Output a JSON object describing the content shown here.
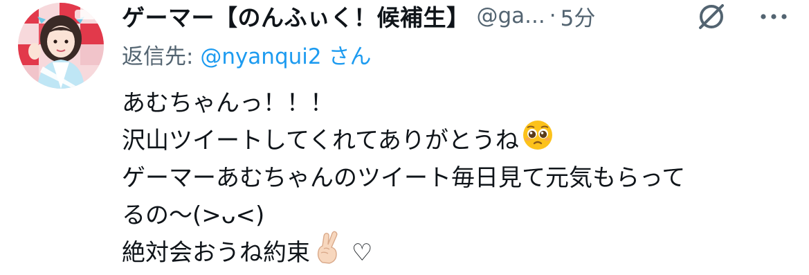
{
  "tweet": {
    "display_name": "ゲーマー【のんふぃく！候補生】",
    "handle": "@ga...",
    "separator": "·",
    "time": "5分",
    "reply_label": "返信先:",
    "reply_user": "@nyanqui2",
    "reply_suffix": "さん",
    "lines": [
      "あむちゃんっ！！！",
      "沢山ツイートしてくれてありがとうね",
      "ゲーマーあむちゃんのツイート毎日見て元気もらって",
      "るの〜(>ᴗ<)",
      "絶対会おうね約束",
      "♡"
    ],
    "emojis": [
      "pleading-face-icon",
      "crossed-fingers-icon"
    ],
    "icons": [
      "grok-icon",
      "more-icon"
    ]
  },
  "colors": {
    "text": "#0f1419",
    "secondary": "#536471",
    "link": "#1d9bf0",
    "background": "#ffffff"
  }
}
